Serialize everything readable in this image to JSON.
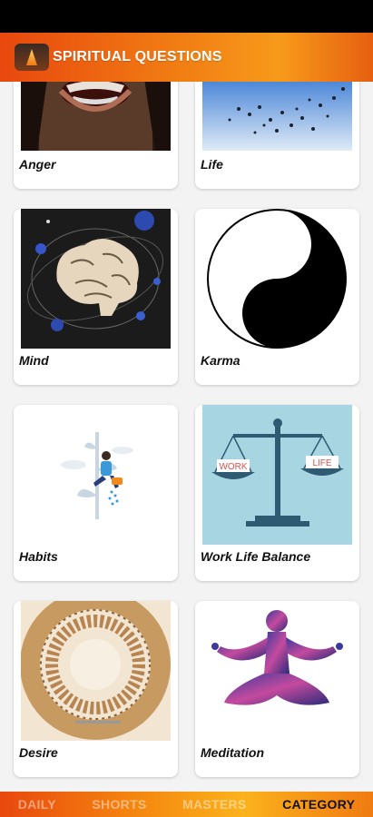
{
  "app": {
    "title": "SPIRITUAL QUESTIONS"
  },
  "categories": [
    {
      "label": "Anger"
    },
    {
      "label": "Life"
    },
    {
      "label": "Mind"
    },
    {
      "label": "Karma"
    },
    {
      "label": "Habits"
    },
    {
      "label": "Work Life Balance"
    },
    {
      "label": "Desire"
    },
    {
      "label": "Meditation"
    }
  ],
  "scale_labels": {
    "left": "WORK",
    "right": "LIFE"
  },
  "nav": {
    "items": [
      {
        "label": "DAILY",
        "active": false
      },
      {
        "label": "SHORTS",
        "active": false
      },
      {
        "label": "MASTERS",
        "active": false
      },
      {
        "label": "CATEGORY",
        "active": true
      }
    ]
  },
  "colors": {
    "brand_start": "#e8480e",
    "brand_mid": "#f79a1a",
    "active_nav": "#111111"
  }
}
